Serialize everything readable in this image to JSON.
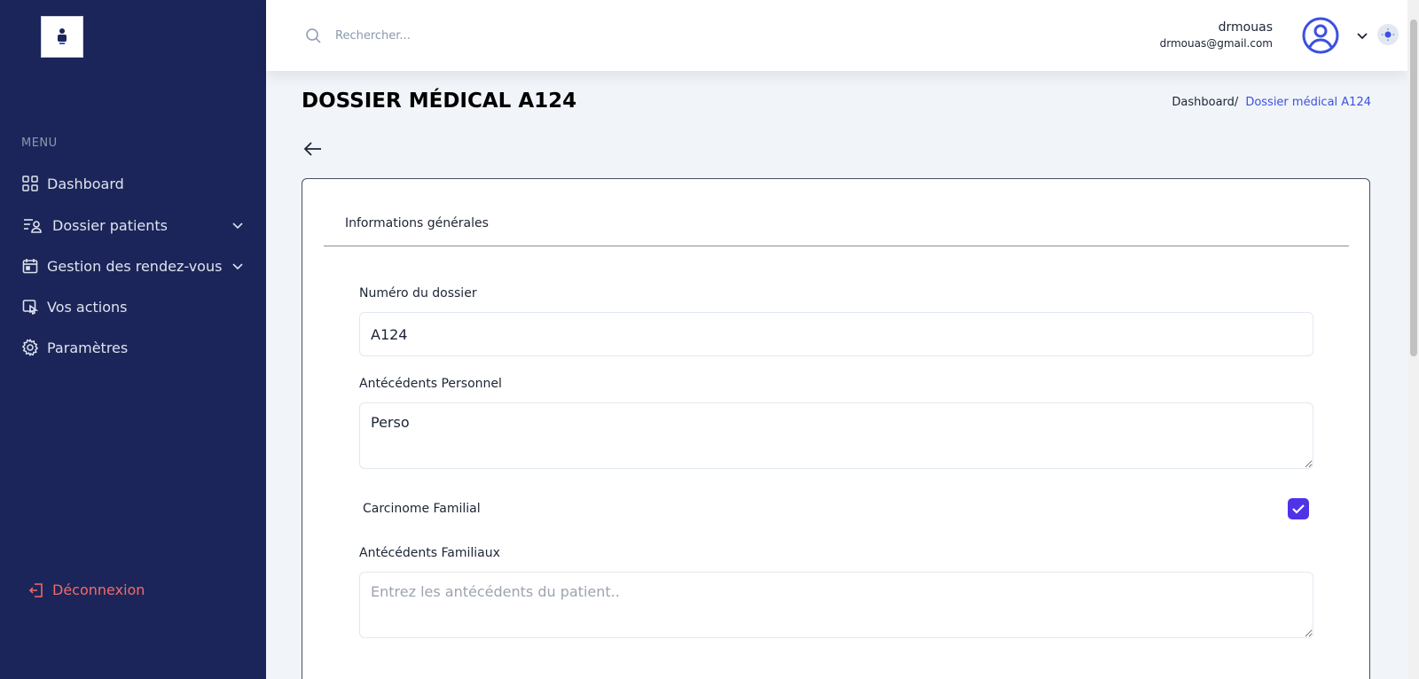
{
  "sidebar": {
    "menu_label": "MENU",
    "items": [
      {
        "label": "Dashboard",
        "icon": "grid-icon"
      },
      {
        "label": "Dossier patients",
        "icon": "patients-list-icon",
        "has_submenu": true
      },
      {
        "label": "Gestion des rendez-vous",
        "icon": "calendar-icon",
        "has_submenu": true
      },
      {
        "label": "Vos actions",
        "icon": "actions-icon"
      },
      {
        "label": "Paramètres",
        "icon": "gear-icon"
      }
    ],
    "logout_label": "Déconnexion"
  },
  "header": {
    "search_placeholder": "Rechercher...",
    "user_name": "drmouas",
    "user_email": "drmouas@gmail.com"
  },
  "page": {
    "title": "DOSSIER MÉDICAL A124",
    "breadcrumb_home": "Dashboard/",
    "breadcrumb_current": "Dossier médical A124"
  },
  "form": {
    "tab_label": "Informations générales",
    "dossier_number_label": "Numéro du dossier",
    "dossier_number_value": "A124",
    "personal_history_label": "Antécédents Personnel",
    "personal_history_value": "Perso",
    "family_carcinoma_label": "Carcinome Familial",
    "family_carcinoma_checked": true,
    "family_history_label": "Antécédents Familiaux",
    "family_history_placeholder": "Entrez les antécédents du patient.."
  },
  "colors": {
    "sidebar_bg": "#1c2559",
    "accent": "#3c50e0",
    "checkbox": "#4f33e6",
    "logout": "#f16b6b"
  }
}
